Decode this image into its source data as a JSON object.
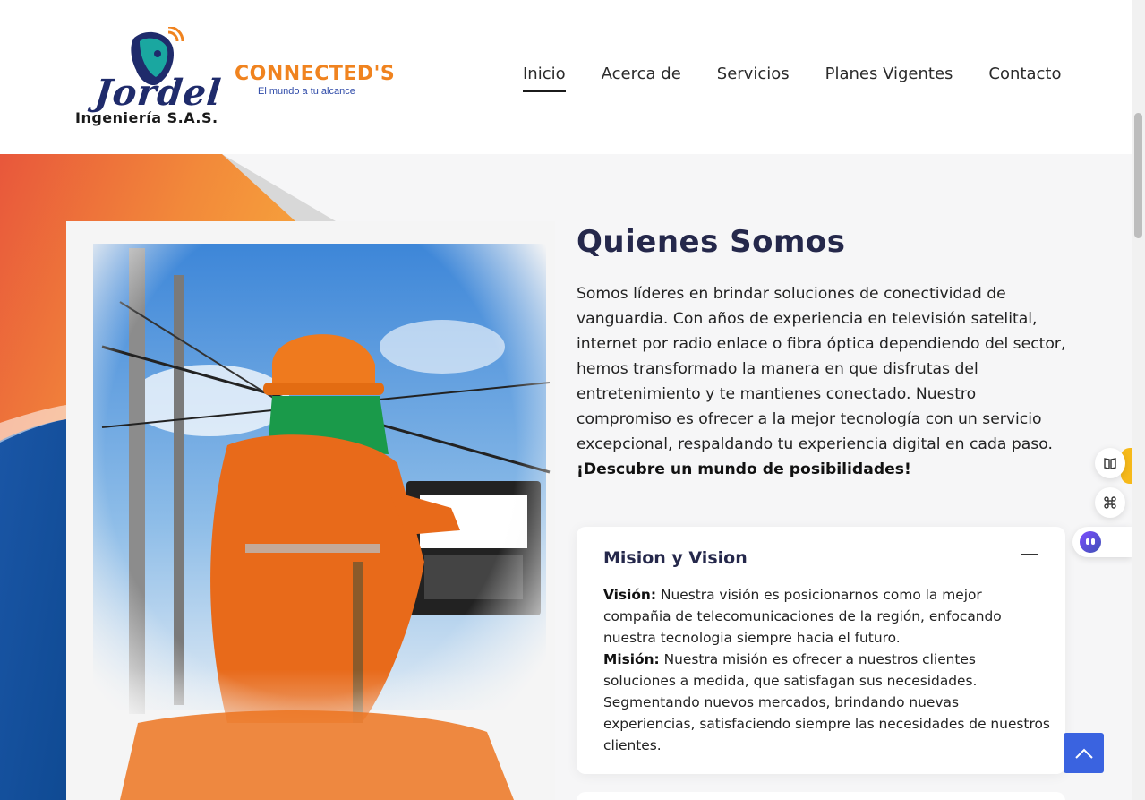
{
  "header": {
    "logo_jordel": {
      "script": "Jordel",
      "sub": "Ingeniería S.A.S."
    },
    "logo_connected": {
      "name": "CONNECTED'S",
      "tagline": "El mundo a tu alcance"
    },
    "nav": [
      {
        "label": "Inicio",
        "active": true
      },
      {
        "label": "Acerca de",
        "active": false
      },
      {
        "label": "Servicios",
        "active": false
      },
      {
        "label": "Planes Vigentes",
        "active": false
      },
      {
        "label": "Contacto",
        "active": false
      }
    ]
  },
  "about": {
    "title": "Quienes Somos",
    "intro": "Somos líderes en brindar soluciones de conectividad de vanguardia. Con años de experiencia en televisión satelital, internet por radio enlace o fibra óptica dependiendo del sector, hemos transformado la manera en que disfrutas del entretenimiento y te mantienes conectado. Nuestro compromiso es ofrecer a la mejor tecnología con un servicio excepcional, respaldando tu experiencia digital en cada paso.",
    "intro_bold": "¡Descubre un mundo de posibilidades!"
  },
  "accordion": {
    "title": "Mision y Vision",
    "toggle_icon": "minus-icon",
    "vision_label": "Visión:",
    "vision_text": "Nuestra visión es posicionarnos como la mejor compañia de telecomunicaciones de la región, enfocando nuestra tecnologia siempre hacia el futuro.",
    "mision_label": "Misión:",
    "mision_text": "Nuestra misión es ofrecer a nuestros clientes soluciones a medida, que satisfagan sus necesidades. Segmentando nuevos mercados, brindando nuevas experiencias, satisfaciendo siempre las necesidades de nuestros clientes."
  },
  "widgets": {
    "book_icon": "book-icon",
    "apps_icon": "command-icon",
    "bot_icon": "chatbot-icon",
    "scroll_top_icon": "chevron-up-icon"
  },
  "colors": {
    "accent_orange": "#f0831f",
    "brand_navy": "#25284b",
    "scroll_button": "#3a63e0",
    "hero_blue": "#1e5fae"
  }
}
